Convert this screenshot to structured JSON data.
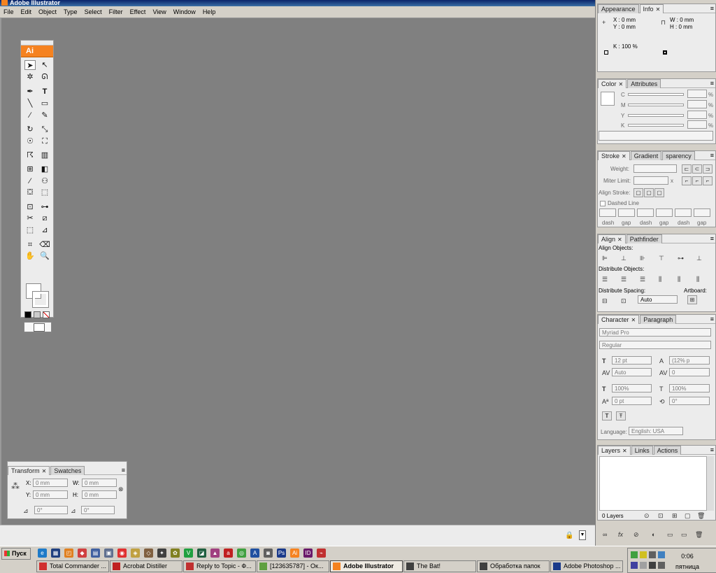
{
  "title": "Adobe Illustrator",
  "menu": [
    "File",
    "Edit",
    "Object",
    "Type",
    "Select",
    "Filter",
    "Effect",
    "View",
    "Window",
    "Help"
  ],
  "toolbox": {
    "logo": "Ai"
  },
  "transform": {
    "tabs": [
      "Transform",
      "Swatches"
    ],
    "x_label": "X:",
    "x_val": "0 mm",
    "y_label": "Y:",
    "y_val": "0 mm",
    "w_label": "W:",
    "w_val": "0 mm",
    "h_label": "H:",
    "h_val": "0 mm",
    "angle1": "0°",
    "angle2": "0°"
  },
  "info": {
    "tabs": [
      "Appearance",
      "Info"
    ],
    "x": "X : 0 mm",
    "y": "Y : 0 mm",
    "w": "W : 0 mm",
    "h": "H : 0 mm",
    "k": "K : 100 %"
  },
  "color": {
    "tabs": [
      "Color",
      "Attributes"
    ],
    "channels": [
      "C",
      "M",
      "Y",
      "K"
    ],
    "pct": "%"
  },
  "stroke": {
    "tabs": [
      "Stroke",
      "Gradient",
      "sparency"
    ],
    "weight": "Weight:",
    "miter": "Miter Limit:",
    "miter_x": "x",
    "align": "Align Stroke:",
    "dashed": "Dashed Line",
    "dash_labels": [
      "dash",
      "gap",
      "dash",
      "gap",
      "dash",
      "gap"
    ]
  },
  "align": {
    "tabs": [
      "Align",
      "Pathfinder"
    ],
    "align_objects": "Align Objects:",
    "distribute_objects": "Distribute Objects:",
    "distribute_spacing": "Distribute Spacing:",
    "artboard": "Artboard:",
    "spacing_val": "Auto"
  },
  "character": {
    "tabs": [
      "Character",
      "Paragraph"
    ],
    "font": "Myriad Pro",
    "style": "Regular",
    "size": "12 pt",
    "leading": "(12% p",
    "kerning": "Auto",
    "tracking": "0",
    "vscale": "100%",
    "hscale": "100%",
    "baseline": "0 pt",
    "rotate": "0°",
    "language_label": "Language:",
    "language": "English: USA"
  },
  "layers": {
    "tabs": [
      "Layers",
      "Links",
      "Actions"
    ],
    "count": "0 Layers"
  },
  "taskbar": {
    "start": "Пуск",
    "tasks": [
      "Total Commander ...",
      "Acrobat Distiller",
      "Reply to Topic - Ф...",
      "[123635787] - Ок...",
      "Adobe Illustrator",
      "The Bat!",
      "Обработка папок",
      "Adobe Photoshop ..."
    ],
    "time": "0:06",
    "day": "пятница"
  },
  "colors": {
    "accent": "#f58220",
    "panel": "#ececec",
    "canvas": "#808080",
    "taskbar": "#d4d0c8"
  }
}
